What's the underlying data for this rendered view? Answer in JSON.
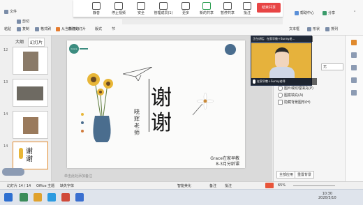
{
  "ribbon": {
    "file_menu": "文件",
    "cut": "剪切",
    "copy": "复制",
    "format_painter": "格式刷",
    "paste": "粘贴",
    "from_current": "从当前开始",
    "new_slide": "新建幻灯片",
    "format": "版式",
    "section": "节",
    "textbox": "文本框",
    "shape": "形状",
    "arrange": "排列",
    "help": "帮助中心",
    "share": "分享",
    "collapse": "⌃"
  },
  "meeting": {
    "tools": [
      "静音",
      "停止视频",
      "安全",
      "管理成员(1)",
      "更多",
      "新的共享",
      "暂停共享",
      "批注"
    ],
    "end_label": "结束共享"
  },
  "left_panel": {
    "tab_outline": "大纲",
    "tab_slides": "幻灯片",
    "slide_numbers": [
      "12",
      "13",
      "14",
      "15"
    ],
    "page_num": "14"
  },
  "slide": {
    "title_char1": "谢",
    "title_char2": "谢",
    "teacher": "晓辉老师",
    "caption_line1": "Grace在家早教",
    "caption_line2": "8-3月分龄课",
    "logo_text": "Grace"
  },
  "video": {
    "top_label": "正在讲话：在家早教＋Sunny老…",
    "bottom_label": "在家早教＋Sunny老师"
  },
  "right_panel": {
    "none_label": "无",
    "options": [
      "图片或纹理填充(P)",
      "图案填充(A)",
      "隐藏背景图形(H)"
    ],
    "apply_all": "全部应用",
    "reset_bg": "重置背景"
  },
  "status": {
    "slide_info": "幻灯片 14 / 14",
    "theme": "Office 主题",
    "missing_font": "缺失字体",
    "add_notes": "单击此处添加备注",
    "smart_beautify": "智能美化",
    "notes": "备注",
    "comment": "批注",
    "zoom": "65%"
  },
  "taskbar": {
    "time": "10:30",
    "date": "2020/3/10"
  }
}
